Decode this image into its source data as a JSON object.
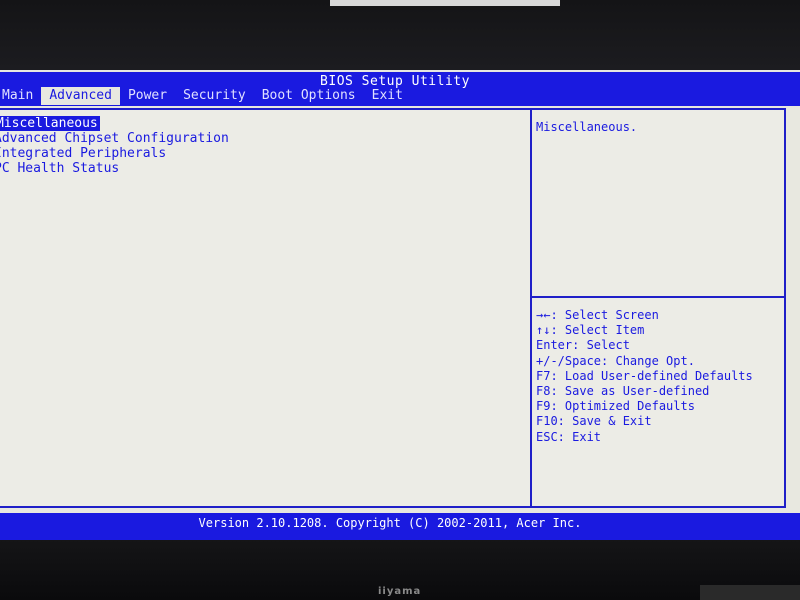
{
  "window": {
    "title": "BIOS Setup Utility"
  },
  "tabs": [
    {
      "label": "Main"
    },
    {
      "label": "Advanced",
      "active": true
    },
    {
      "label": "Power"
    },
    {
      "label": "Security"
    },
    {
      "label": "Boot Options"
    },
    {
      "label": "Exit"
    }
  ],
  "menu": [
    {
      "label": "Miscellaneous",
      "selected": true
    },
    {
      "label": "Advanced Chipset Configuration"
    },
    {
      "label": "Integrated Peripherals"
    },
    {
      "label": "PC Health Status"
    }
  ],
  "help": {
    "text": "Miscellaneous."
  },
  "keys": [
    {
      "text": "→←: Select Screen"
    },
    {
      "text": "↑↓: Select Item"
    },
    {
      "text": "Enter: Select"
    },
    {
      "text": "+/-/Space: Change Opt."
    },
    {
      "text": "F7: Load User-defined Defaults"
    },
    {
      "text": "F8: Save as User-defined"
    },
    {
      "text": "F9: Optimized Defaults"
    },
    {
      "text": "F10: Save & Exit"
    },
    {
      "text": "ESC: Exit"
    }
  ],
  "status": {
    "text": "Version 2.10.1208. Copyright (C) 2002-2011, Acer Inc."
  },
  "monitor": {
    "brand": "iiyama"
  },
  "colors": {
    "bios_blue": "#1a1ae0",
    "bios_background": "#e8e8e0",
    "text_white": "#ffffff"
  }
}
